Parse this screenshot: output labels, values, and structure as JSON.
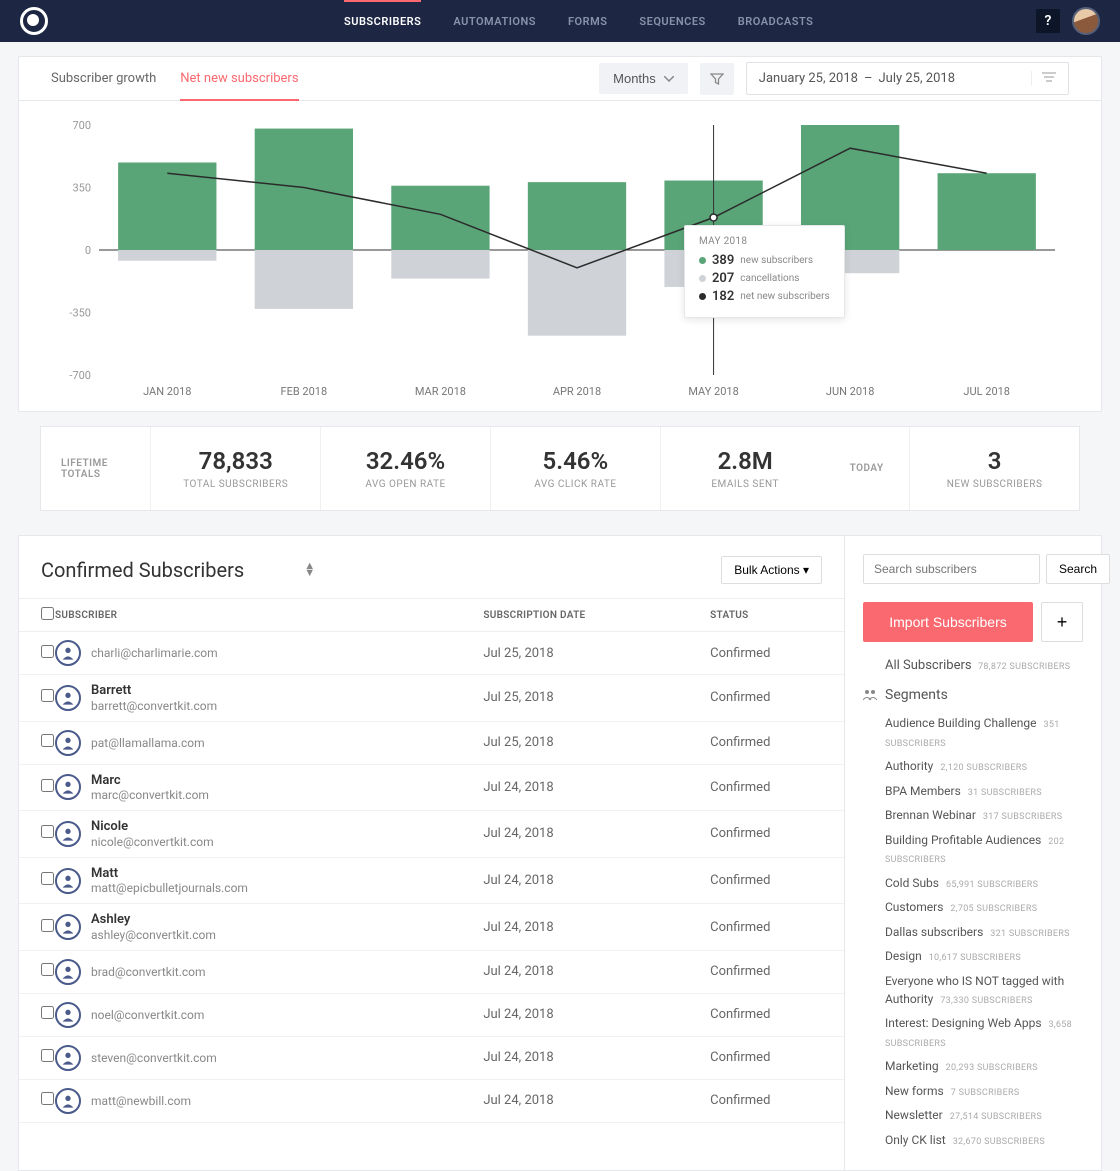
{
  "nav": {
    "tabs": [
      "SUBSCRIBERS",
      "AUTOMATIONS",
      "FORMS",
      "SEQUENCES",
      "BROADCASTS"
    ],
    "help": "?"
  },
  "viewTabs": {
    "growth": "Subscriber growth",
    "net": "Net new subscribers"
  },
  "controls": {
    "interval": "Months",
    "date_from": "January 25, 2018",
    "date_sep": "–",
    "date_to": "July 25, 2018"
  },
  "chart_data": {
    "type": "bar",
    "categories": [
      "JAN 2018",
      "FEB 2018",
      "MAR 2018",
      "APR 2018",
      "MAY 2018",
      "JUN 2018",
      "JUL 2018"
    ],
    "series": [
      {
        "name": "new subscribers",
        "color": "#5aa578",
        "values": [
          490,
          680,
          360,
          380,
          389,
          700,
          430
        ]
      },
      {
        "name": "cancellations",
        "color": "#cfd3d7",
        "values": [
          -60,
          -330,
          -160,
          -480,
          -207,
          -130,
          0
        ]
      },
      {
        "name": "net new subscribers",
        "color": "#2b2b2b",
        "values": [
          430,
          350,
          200,
          -100,
          182,
          570,
          430
        ]
      }
    ],
    "y_ticks": [
      700,
      350,
      0,
      -350,
      -700
    ],
    "ylim": [
      -700,
      700
    ]
  },
  "tooltip": {
    "title": "MAY 2018",
    "rows": [
      {
        "color": "#5aa578",
        "value": "389",
        "label": "new subscribers"
      },
      {
        "color": "#cfd3d7",
        "value": "207",
        "label": "cancellations"
      },
      {
        "color": "#2b2b2b",
        "value": "182",
        "label": "net new subscribers"
      }
    ]
  },
  "stats": {
    "lifetime_label": "LIFETIME TOTALS",
    "items": [
      {
        "value": "78,833",
        "label": "TOTAL SUBSCRIBERS"
      },
      {
        "value": "32.46%",
        "label": "AVG OPEN RATE"
      },
      {
        "value": "5.46%",
        "label": "AVG CLICK RATE"
      },
      {
        "value": "2.8M",
        "label": "EMAILS SENT"
      }
    ],
    "today_label": "TODAY",
    "today": {
      "value": "3",
      "label": "NEW SUBSCRIBERS"
    }
  },
  "subs": {
    "title": "Confirmed Subscribers",
    "bulk": "Bulk Actions",
    "headers": {
      "sub": "SUBSCRIBER",
      "date": "SUBSCRIPTION DATE",
      "status": "STATUS"
    },
    "rows": [
      {
        "name": "",
        "email": "charli@charlimarie.com",
        "date": "Jul 25, 2018",
        "status": "Confirmed"
      },
      {
        "name": "Barrett",
        "email": "barrett@convertkit.com",
        "date": "Jul 25, 2018",
        "status": "Confirmed"
      },
      {
        "name": "",
        "email": "pat@llamallama.com",
        "date": "Jul 25, 2018",
        "status": "Confirmed"
      },
      {
        "name": "Marc",
        "email": "marc@convertkit.com",
        "date": "Jul 24, 2018",
        "status": "Confirmed"
      },
      {
        "name": "Nicole",
        "email": "nicole@convertkit.com",
        "date": "Jul 24, 2018",
        "status": "Confirmed"
      },
      {
        "name": "Matt",
        "email": "matt@epicbulletjournals.com",
        "date": "Jul 24, 2018",
        "status": "Confirmed"
      },
      {
        "name": "Ashley",
        "email": "ashley@convertkit.com",
        "date": "Jul 24, 2018",
        "status": "Confirmed"
      },
      {
        "name": "",
        "email": "brad@convertkit.com",
        "date": "Jul 24, 2018",
        "status": "Confirmed"
      },
      {
        "name": "",
        "email": "noel@convertkit.com",
        "date": "Jul 24, 2018",
        "status": "Confirmed"
      },
      {
        "name": "",
        "email": "steven@convertkit.com",
        "date": "Jul 24, 2018",
        "status": "Confirmed"
      },
      {
        "name": "",
        "email": "matt@newbill.com",
        "date": "Jul 24, 2018",
        "status": "Confirmed"
      }
    ]
  },
  "side": {
    "search_ph": "Search subscribers",
    "search_btn": "Search",
    "import": "Import Subscribers",
    "plus": "+",
    "all_label": "All Subscribers",
    "all_count": "78,872 SUBSCRIBERS",
    "seg_title": "Segments",
    "segments": [
      {
        "name": "Audience Building Challenge",
        "count": "351 SUBSCRIBERS"
      },
      {
        "name": "Authority",
        "count": "2,120 SUBSCRIBERS"
      },
      {
        "name": "BPA Members",
        "count": "31 SUBSCRIBERS"
      },
      {
        "name": "Brennan Webinar",
        "count": "317 SUBSCRIBERS"
      },
      {
        "name": "Building Profitable Audiences",
        "count": "202 SUBSCRIBERS"
      },
      {
        "name": "Cold Subs",
        "count": "65,991 SUBSCRIBERS"
      },
      {
        "name": "Customers",
        "count": "2,705 SUBSCRIBERS"
      },
      {
        "name": "Dallas subscribers",
        "count": "321 SUBSCRIBERS"
      },
      {
        "name": "Design",
        "count": "10,617 SUBSCRIBERS"
      },
      {
        "name": "Everyone who IS NOT tagged with Authority",
        "count": "73,330 SUBSCRIBERS"
      },
      {
        "name": "Interest: Designing Web Apps",
        "count": "3,658 SUBSCRIBERS"
      },
      {
        "name": "Marketing",
        "count": "20,293 SUBSCRIBERS"
      },
      {
        "name": "New forms",
        "count": "7 SUBSCRIBERS"
      },
      {
        "name": "Newsletter",
        "count": "27,514 SUBSCRIBERS"
      },
      {
        "name": "Only CK list",
        "count": "32,670 SUBSCRIBERS"
      }
    ]
  }
}
